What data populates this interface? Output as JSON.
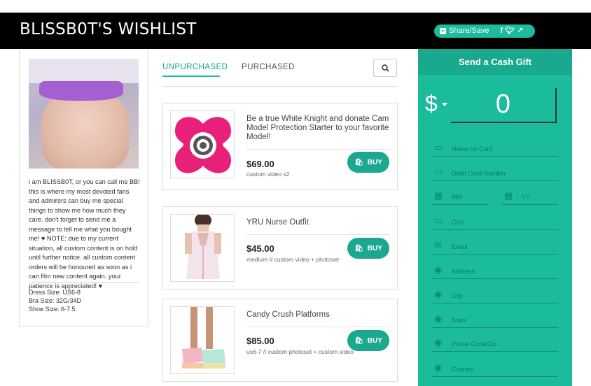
{
  "header": {
    "title": "BLISSB0T'S WISHLIST",
    "share_label": "Share/Save",
    "social_icons": [
      "facebook-icon",
      "twitter-icon",
      "share-icon"
    ]
  },
  "profile": {
    "bio": "i am BLISSB0T, or you can call me BB! this is where my most devoted fans and admirers can buy me special things to show me how much they care. don't forget to send me a message to tell me what you bought me! ♥ NOTE: due to my current situation, all custom content is on hold until further notice. all custom content orders will be honoured as soon as i can film new content again. your patience is appreciated! ♥",
    "dress_size": "Dress Size: US6-8",
    "bra_size": "Bra Size: 32G/34D",
    "shoe_size": "Shoe Size: 6-7.5"
  },
  "tabs": {
    "unpurchased": "UNPURCHASED",
    "purchased": "PURCHASED"
  },
  "items": [
    {
      "name": "Be a true White Knight and donate Cam Model Protection Starter to your favorite Model!",
      "price": "$69.00",
      "note": "custom video x2",
      "buy_label": "BUY"
    },
    {
      "name": "YRU Nurse Outfit",
      "price": "$45.00",
      "note": "medium // custom video + photoset",
      "buy_label": "BUY"
    },
    {
      "name": "Candy Crush Platforms",
      "price": "$85.00",
      "note": "us6-7 // custom photoset + custom video",
      "buy_label": "BUY"
    }
  ],
  "gift": {
    "title": "Send a Cash Gift",
    "currency": "$",
    "amount": "0",
    "fields": {
      "name_on_card": "Name on Card",
      "card_number": "Debit Card Number",
      "mm": "MM",
      "yy": "YY",
      "cvv": "CVV",
      "email": "Email",
      "address": "Address",
      "city": "City",
      "state": "State",
      "postal": "Postal Code/Zip",
      "country": "Country"
    }
  },
  "colors": {
    "accent": "#1abc9c",
    "accent_dark": "#1aa88e",
    "header_bg": "#000000"
  }
}
